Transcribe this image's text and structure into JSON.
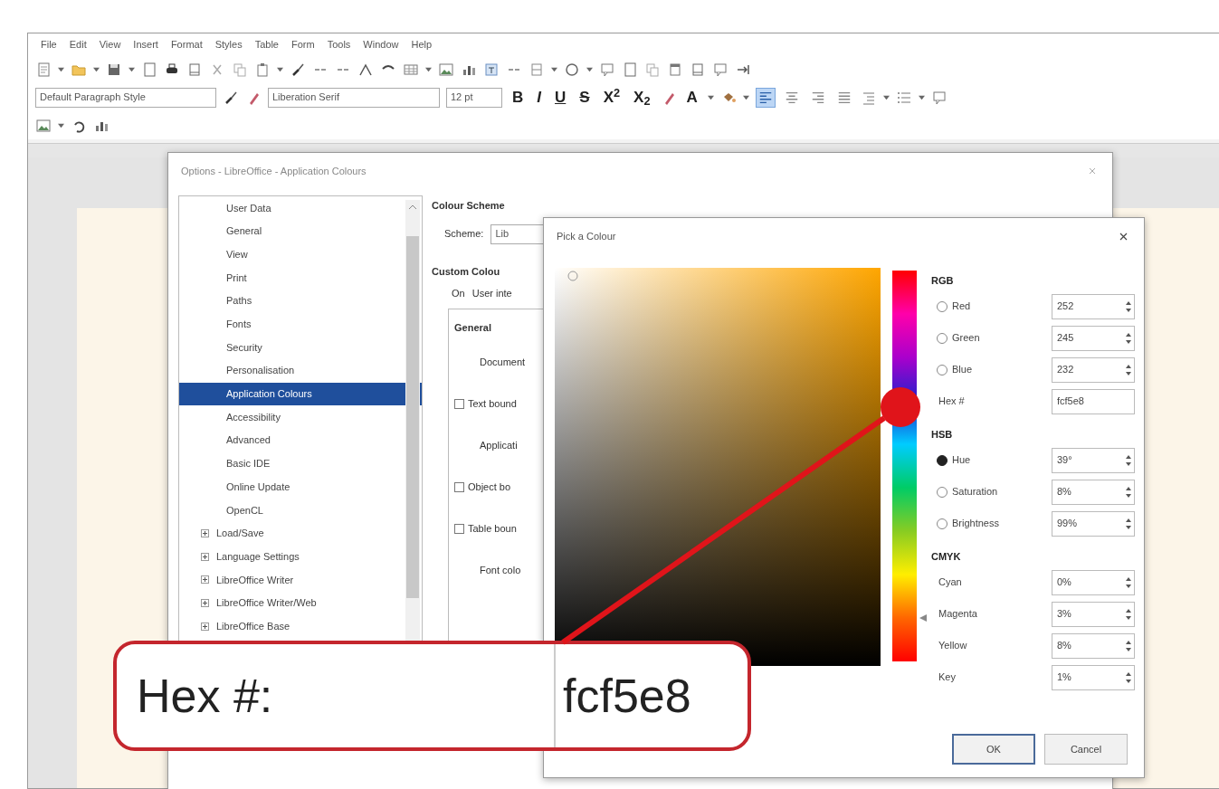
{
  "menu": [
    "File",
    "Edit",
    "View",
    "Insert",
    "Format",
    "Styles",
    "Table",
    "Form",
    "Tools",
    "Window",
    "Help"
  ],
  "formatting": {
    "paragraph_style": "Default Paragraph Style",
    "font_name": "Liberation Serif",
    "font_size": "12 pt",
    "text_buttons": [
      "B",
      "I",
      "U",
      "S",
      "X$^{2}$",
      "X$_{2}$"
    ],
    "font_colour_button": "A",
    "align": [
      {
        "selected": true
      },
      {
        "selected": false
      },
      {
        "selected": false
      },
      {
        "selected": false
      }
    ]
  },
  "options_dialog": {
    "title": "Options - LibreOffice - Application Colours",
    "tree": [
      {
        "children": [
          {
            "label": "User Data",
            "selected": false
          },
          {
            "label": "General",
            "selected": false
          },
          {
            "label": "View",
            "selected": false
          },
          {
            "label": "Print",
            "selected": false
          },
          {
            "label": "Paths",
            "selected": false
          },
          {
            "label": "Fonts",
            "selected": false
          },
          {
            "label": "Security",
            "selected": false
          },
          {
            "label": "Personalisation",
            "selected": false
          },
          {
            "label": "Application Colours",
            "selected": true
          },
          {
            "label": "Accessibility",
            "selected": false
          },
          {
            "label": "Advanced",
            "selected": false
          },
          {
            "label": "Basic IDE",
            "selected": false
          },
          {
            "label": "Online Update",
            "selected": false
          },
          {
            "label": "OpenCL",
            "selected": false
          }
        ]
      },
      {
        "label": "Load/Save",
        "expanded": false,
        "selected": false
      },
      {
        "label": "Language Settings",
        "expanded": false,
        "selected": false
      },
      {
        "label": "LibreOffice Writer",
        "expanded": false,
        "selected": false
      },
      {
        "label": "LibreOffice Writer/Web",
        "expanded": false,
        "selected": false
      },
      {
        "label": "LibreOffice Base",
        "expanded": false,
        "selected": false
      }
    ],
    "panel": {
      "heading": "Colour Scheme",
      "scheme_label": "Scheme:",
      "scheme_value": "Lib",
      "custom_heading": "Custom Colou",
      "column_on": "On",
      "column_name": "User inte",
      "rows": [
        {
          "kind": "group",
          "label": "General"
        },
        {
          "kind": "label",
          "label": "Document"
        },
        {
          "kind": "check",
          "label": "Text bound",
          "checked": false
        },
        {
          "kind": "label",
          "label": "Applicati"
        },
        {
          "kind": "check",
          "label": "Object bo",
          "checked": false
        },
        {
          "kind": "check",
          "label": "Table boun",
          "checked": false
        },
        {
          "kind": "label",
          "label": "Font colo"
        }
      ]
    }
  },
  "colour_dialog": {
    "title": "Pick a Colour",
    "hue_slider": {
      "level": 0.11
    },
    "groups": [
      {
        "heading": "RGB",
        "fields": [
          {
            "kind": "radio",
            "label": "Red",
            "value": "252",
            "selected": false
          },
          {
            "kind": "radio",
            "label": "Green",
            "value": "245",
            "selected": false
          },
          {
            "kind": "radio",
            "label": "Blue",
            "value": "232",
            "selected": false
          },
          {
            "kind": "hex",
            "label": "Hex #",
            "value": "fcf5e8"
          }
        ]
      },
      {
        "heading": "HSB",
        "fields": [
          {
            "kind": "radio",
            "label": "Hue",
            "value": "39°",
            "selected": true
          },
          {
            "kind": "radio",
            "label": "Saturation",
            "value": "8%",
            "selected": false
          },
          {
            "kind": "radio",
            "label": "Brightness",
            "value": "99%",
            "selected": false
          }
        ]
      },
      {
        "heading": "CMYK",
        "fields": [
          {
            "kind": "plain",
            "label": "Cyan",
            "value": "0%"
          },
          {
            "kind": "plain",
            "label": "Magenta",
            "value": "3%"
          },
          {
            "kind": "plain",
            "label": "Yellow",
            "value": "8%"
          },
          {
            "kind": "plain",
            "label": "Key",
            "value": "1%"
          }
        ]
      }
    ],
    "buttons": [
      {
        "label": "OK",
        "default": true
      },
      {
        "label": "Cancel",
        "default": false
      }
    ]
  },
  "callout": {
    "label": "Hex #:",
    "value": "fcf5e8"
  }
}
